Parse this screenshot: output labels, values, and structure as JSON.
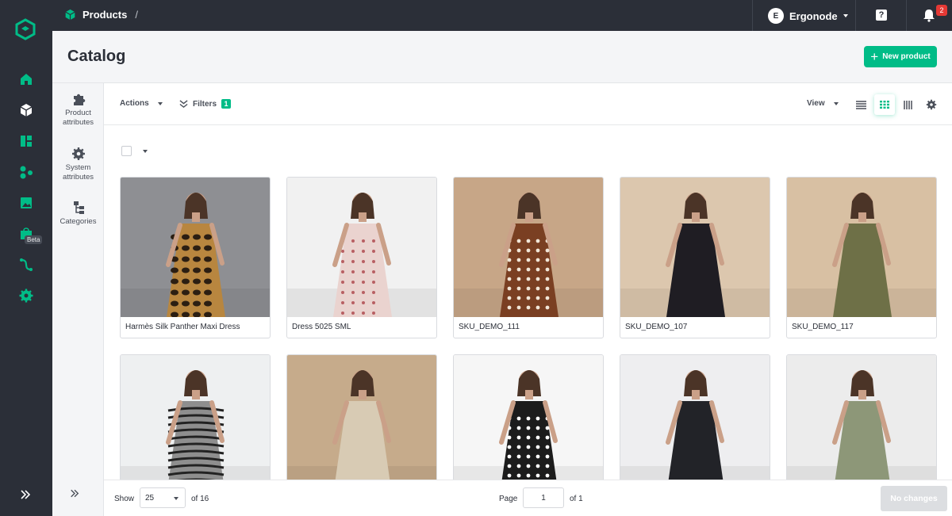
{
  "colors": {
    "accent": "#00bc87",
    "rail": "#2b2f38",
    "badge": "#e53935"
  },
  "rail": {
    "items": [
      "home-icon",
      "products-icon",
      "dashboard-icon",
      "integrations-icon",
      "media-icon",
      "bag-icon",
      "workflow-icon",
      "settings-icon"
    ],
    "beta_label": "Beta"
  },
  "topbar": {
    "breadcrumb": "Products",
    "breadcrumb_sep": "/",
    "user_initial": "E",
    "user_name": "Ergonode",
    "help_label": "?",
    "notification_count": "2"
  },
  "header": {
    "title": "Catalog",
    "new_button": "New product"
  },
  "side_panel": {
    "items": [
      {
        "label_line1": "Product",
        "label_line2": "attributes"
      },
      {
        "label_line1": "System",
        "label_line2": "attributes"
      },
      {
        "label_line1": "Categories",
        "label_line2": ""
      }
    ]
  },
  "toolbar": {
    "actions_label": "Actions",
    "filters_label": "Filters",
    "filters_count": "1",
    "view_label": "View"
  },
  "products": [
    {
      "name": "Harmès Silk Panther Maxi Dress",
      "bg": "#8e8f93",
      "dress": "#b8863f",
      "pattern": "leopard"
    },
    {
      "name": "Dress 5025 SML",
      "bg": "#f1f1f1",
      "dress": "#ead3cf",
      "pattern": "floral"
    },
    {
      "name": "SKU_DEMO_111",
      "bg": "#c7a687",
      "dress": "#7a3f22",
      "pattern": "dots"
    },
    {
      "name": "SKU_DEMO_107",
      "bg": "#dcc7ae",
      "dress": "#1f1d23",
      "pattern": "plain"
    },
    {
      "name": "SKU_DEMO_117",
      "bg": "#d8c0a3",
      "dress": "#6e7047",
      "pattern": "plain"
    },
    {
      "name": "",
      "bg": "#eef0f1",
      "dress": "#8e8e8e",
      "pattern": "zebra"
    },
    {
      "name": "",
      "bg": "#c6ab8b",
      "dress": "#d8cbb4",
      "pattern": "plain"
    },
    {
      "name": "",
      "bg": "#f6f6f6",
      "dress": "#1c1c1c",
      "pattern": "dots"
    },
    {
      "name": "",
      "bg": "#eeeef0",
      "dress": "#222328",
      "pattern": "plain"
    },
    {
      "name": "",
      "bg": "#ececec",
      "dress": "#8d9778",
      "pattern": "plain"
    }
  ],
  "footer": {
    "show_label": "Show",
    "per_page": "25",
    "of_total": "of 16",
    "page_label": "Page",
    "page_value": "1",
    "of_pages": "of 1",
    "save_label": "No changes"
  }
}
